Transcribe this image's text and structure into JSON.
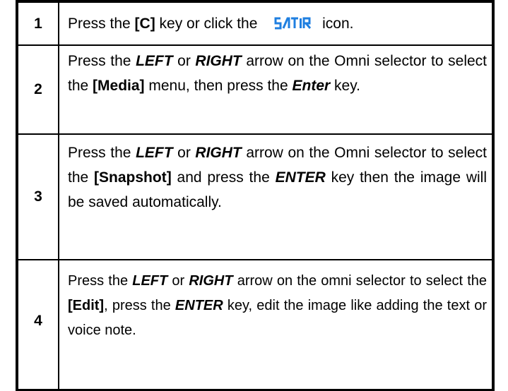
{
  "brand": {
    "logo_text": "SATIR",
    "logo_color": "#1f7fe0"
  },
  "steps": [
    {
      "number": "1",
      "parts": [
        {
          "text": "Press the ",
          "style": "normal"
        },
        {
          "text": "[C]",
          "style": "bold"
        },
        {
          "text": " key or click the ",
          "style": "normal"
        },
        {
          "text": "SATIR",
          "style": "logo"
        },
        {
          "text": " icon.",
          "style": "normal"
        }
      ]
    },
    {
      "number": "2",
      "parts": [
        {
          "text": "Press the ",
          "style": "normal"
        },
        {
          "text": "LEFT",
          "style": "bold-italic"
        },
        {
          "text": " or ",
          "style": "normal"
        },
        {
          "text": "RIGHT",
          "style": "bold-italic"
        },
        {
          "text": " arrow on the Omni selector to select the ",
          "style": "normal"
        },
        {
          "text": "[Media]",
          "style": "bold"
        },
        {
          "text": " menu, then press the ",
          "style": "normal"
        },
        {
          "text": "Enter",
          "style": "bold-italic"
        },
        {
          "text": " key.",
          "style": "normal"
        }
      ]
    },
    {
      "number": "3",
      "parts": [
        {
          "text": "Press the ",
          "style": "normal"
        },
        {
          "text": "LEFT",
          "style": "bold-italic"
        },
        {
          "text": " or ",
          "style": "normal"
        },
        {
          "text": "RIGHT",
          "style": "bold-italic"
        },
        {
          "text": " arrow on the Omni selector to select the ",
          "style": "normal"
        },
        {
          "text": "[Snapshot]",
          "style": "bold"
        },
        {
          "text": " and press the ",
          "style": "normal"
        },
        {
          "text": "ENTER",
          "style": "bold-italic"
        },
        {
          "text": " key then the image will be saved automatically.",
          "style": "normal"
        }
      ]
    },
    {
      "number": "4",
      "parts": [
        {
          "text": "Press the ",
          "style": "normal"
        },
        {
          "text": "LEFT",
          "style": "bold-italic"
        },
        {
          "text": " or ",
          "style": "normal"
        },
        {
          "text": "RIGHT",
          "style": "bold-italic"
        },
        {
          "text": " arrow on the omni selector to select the ",
          "style": "normal"
        },
        {
          "text": "[Edit]",
          "style": "bold"
        },
        {
          "text": ", press the ",
          "style": "normal"
        },
        {
          "text": "ENTER",
          "style": "bold-italic"
        },
        {
          "text": " key, edit the image like adding the text or voice note.",
          "style": "normal"
        }
      ]
    }
  ]
}
